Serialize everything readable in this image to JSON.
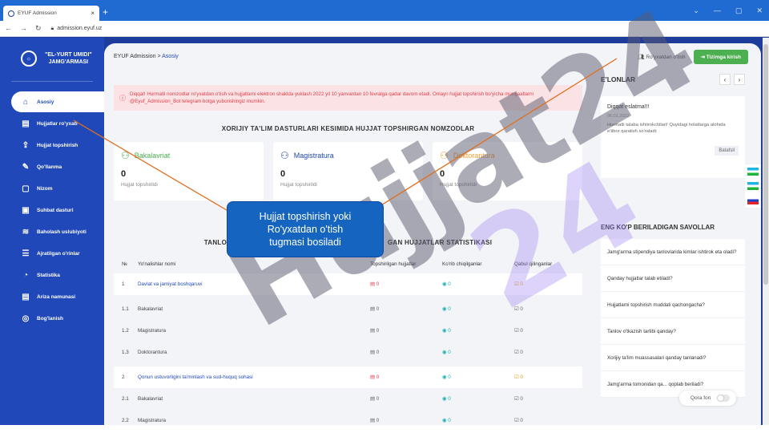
{
  "browser": {
    "tab_title": "EYUF Admission",
    "new_tab": "+",
    "close": "×",
    "url": "admission.eyuf.uz"
  },
  "sidebar": {
    "brand_line1": "\"EL-YURT UMIDI\"",
    "brand_line2": "JAMG'ARMASI",
    "items": [
      {
        "label": "Asosiy",
        "icon": "⌂"
      },
      {
        "label": "Hujjatlar ro'yxati",
        "icon": "▤"
      },
      {
        "label": "Hujjat topshirish",
        "icon": "⇪"
      },
      {
        "label": "Qo'llanma",
        "icon": "✎"
      },
      {
        "label": "Nizom",
        "icon": "▢"
      },
      {
        "label": "Suhbat dasturi",
        "icon": "▣"
      },
      {
        "label": "Baholash uslubiyoti",
        "icon": "≋"
      },
      {
        "label": "Ajratilgan o'rinlar",
        "icon": "☰"
      },
      {
        "label": "Statistika",
        "icon": "◔"
      },
      {
        "label": "Ariza namunasi",
        "icon": "▤"
      },
      {
        "label": "Bog'lanish",
        "icon": "◎"
      }
    ]
  },
  "header": {
    "crumb_root": "EYUF Admission",
    "crumb_sep": ">",
    "crumb_current": "Asosiy",
    "register": "Ro'yxatdan o'tish",
    "login": "Tizimga kirish"
  },
  "alert": {
    "text": "Diqqat! Hurmatli nomzodlar ro'yxatdan o'tish va hujjatlarni elektron shaklda yuklash 2022 yil 10 yanvardan 10 fevralga qadar davom etadi. Onlayn hujjat topshirish bo'yicha murojaatlarni @Eyuf_Admission_Bot telegram botga yuborishingiz mumkin."
  },
  "section_title": "XORIJIY TA'LIM DASTURLARI KESIMIDA HUJJAT TOPSHIRGAN NOMZODLAR",
  "cards": [
    {
      "title": "Bakalavriat",
      "value": "0",
      "sub": "Hujjat topshirildi"
    },
    {
      "title": "Magistratura",
      "value": "0",
      "sub": "Hujjat topshirildi"
    },
    {
      "title": "Doktorantura",
      "value": "0",
      "sub": "Hujjat topshirildi"
    }
  ],
  "stats": {
    "title_left": "TANLOV",
    "title_right": "GAN HUJJATLAR STATISTIKASI",
    "headers": {
      "no": "№",
      "name": "Yo'nalishlar nomi",
      "submitted": "Topshirilgan hujjatlar",
      "viewed": "Ko'rib chiqilganlar",
      "accepted": "Qabul qilinganlar"
    },
    "rows": [
      {
        "no": "1",
        "name": "Davlat va jamiyat boshqaruvi",
        "s": "0",
        "k": "0",
        "q": "0",
        "hl": true
      },
      {
        "no": "1.1",
        "name": "Bakalavriat",
        "s": "0",
        "k": "0",
        "q": "0",
        "hl": false
      },
      {
        "no": "1.2",
        "name": "Magistratura",
        "s": "0",
        "k": "0",
        "q": "0",
        "hl": false
      },
      {
        "no": "1.3",
        "name": "Doktorantura",
        "s": "0",
        "k": "0",
        "q": "0",
        "hl": false
      },
      {
        "no": "2",
        "name": "Qonun ustuvorligini ta'minlash va sud-huquq sohasi",
        "s": "0",
        "k": "0",
        "q": "0",
        "hl": true
      },
      {
        "no": "2.1",
        "name": "Bakalavriat",
        "s": "0",
        "k": "0",
        "q": "0",
        "hl": false
      },
      {
        "no": "2.2",
        "name": "Magistratura",
        "s": "0",
        "k": "0",
        "q": "0",
        "hl": false
      }
    ]
  },
  "news": {
    "heading": "E'LONLAR",
    "prev": "‹",
    "next": "›",
    "title": "Diqqat eslatma!!!",
    "date": "06.01.2022",
    "text": "Hurmatli talaba ishtirokchilari! Quyidagi holatlarga alohida e'tibor qaratish so'raladi:",
    "more": "Batafsil"
  },
  "faq": {
    "heading": "ENG KO'P BERILADIGAN SAVOLLAR",
    "items": [
      "Jamg'arma stipendiya tanlovlarida kimlar ishtirok eta oladi?",
      "Qanday hujjatlar talab etiladi?",
      "Hujjatlarni topshirish muddati qachongacha?",
      "Tanlov o'tkazish tartibi qanday?",
      "Xorijiy ta'lim muassasalari qanday tanlanadi?",
      "Jamg'arma tomonidan qa... qoplab beriladi?"
    ]
  },
  "theme_toggle": "Qora fon",
  "callout": {
    "line1": "Hujjat topshirish yoki",
    "line2": "Ro'yxatdan o'tish",
    "line3": "tugmasi bosiladi"
  },
  "watermark": "Hujjat24",
  "colors": {
    "sidebar": "#2048b8",
    "accent_green": "#4caf50",
    "alert": "#e0404a",
    "callout": "#1565c0"
  }
}
